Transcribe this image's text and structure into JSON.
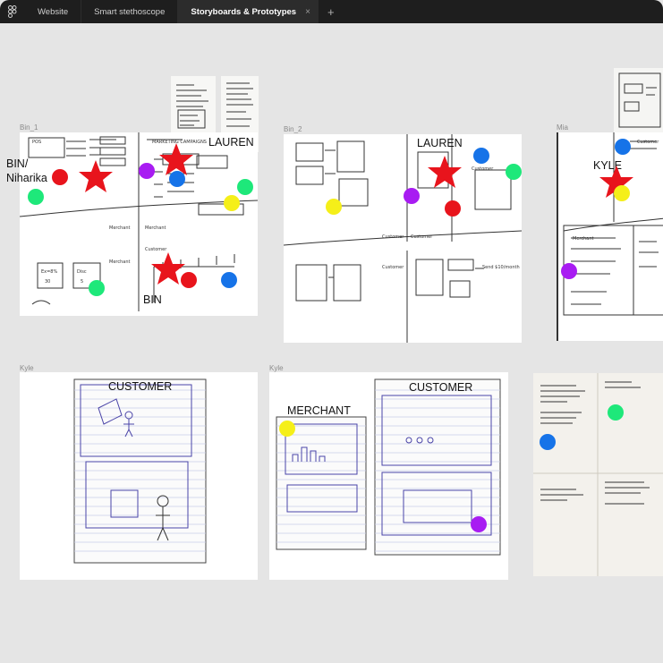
{
  "tabs": [
    {
      "label": "Website"
    },
    {
      "label": "Smart stethoscope"
    },
    {
      "label": "Storyboards & Prototypes",
      "close": "×"
    }
  ],
  "new_tab": "+",
  "frames": {
    "bin1": {
      "label": "Bin_1"
    },
    "bin2": {
      "label": "Bin_2"
    },
    "mia": {
      "label": "Mia"
    },
    "kyle1": {
      "label": "Kyle"
    },
    "kyle2": {
      "label": "Kyle"
    }
  },
  "annotations": {
    "bin_niharika": "BIN/\nNiharika",
    "lauren1": "LAUREN",
    "bin": "BIN",
    "lauren2": "LAUREN",
    "kyle": "KYLE",
    "customer1": "CUSTOMER",
    "merchant": "MERCHANT",
    "customer2": "CUSTOMER"
  },
  "colors": {
    "red": "#e8141c",
    "green": "#1ee87a",
    "purple": "#a81cf2",
    "blue": "#1673e8",
    "yellow": "#f5ef19",
    "canvas": "#e5e5e5",
    "tabbar": "#1e1e1e"
  },
  "icons": {
    "app": "figma-logo-icon",
    "close": "close-icon",
    "plus": "plus-icon"
  }
}
